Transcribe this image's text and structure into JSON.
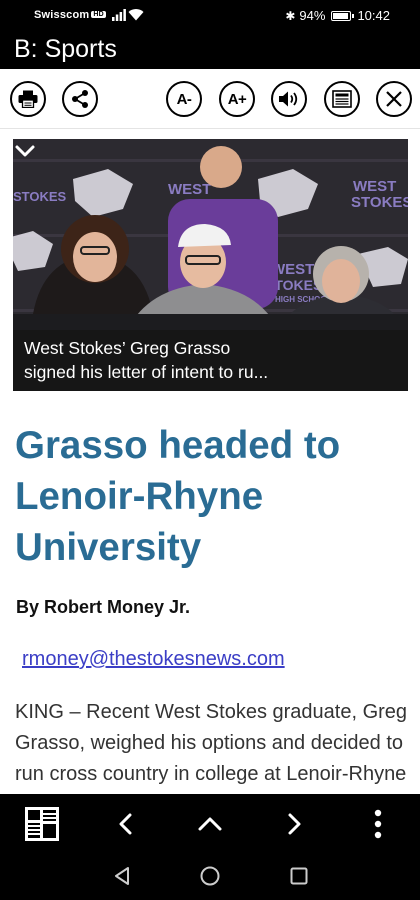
{
  "status_bar": {
    "carrier": "Swisscom",
    "network_badge": "HD",
    "bluetooth_symbol": "✱",
    "battery_level": "94%",
    "battery_fraction": 0.94,
    "time": "10:42"
  },
  "title_bar": {
    "title": "B: Sports"
  },
  "toolbar": {
    "font_smaller_label": "A-",
    "font_larger_label": "A+",
    "icons": [
      "print-icon",
      "share-icon",
      "speaker-icon",
      "article-view-icon",
      "close-icon"
    ]
  },
  "hero": {
    "caption_line1": "West Stokes’ Greg Grasso",
    "caption_line2": "signed his letter of intent to ru...",
    "backdrop_text_line1": "WEST",
    "backdrop_text_line2": "STOKES",
    "backdrop_text_line3": "HIGH SCHOOL"
  },
  "article": {
    "headline": "Grasso headed to Lenoir-Rhyne University",
    "byline": "By Robert Money Jr.",
    "email": "rmoney@thestokesnews.com",
    "body": "KING – Recent West Stokes graduate, Greg Grasso, weighed his options and decided to run cross country in college at Lenoir-Rhyne University."
  },
  "colors": {
    "headline": "#2a6c94",
    "link": "#3b3ec6",
    "bar_background": "#000000"
  }
}
